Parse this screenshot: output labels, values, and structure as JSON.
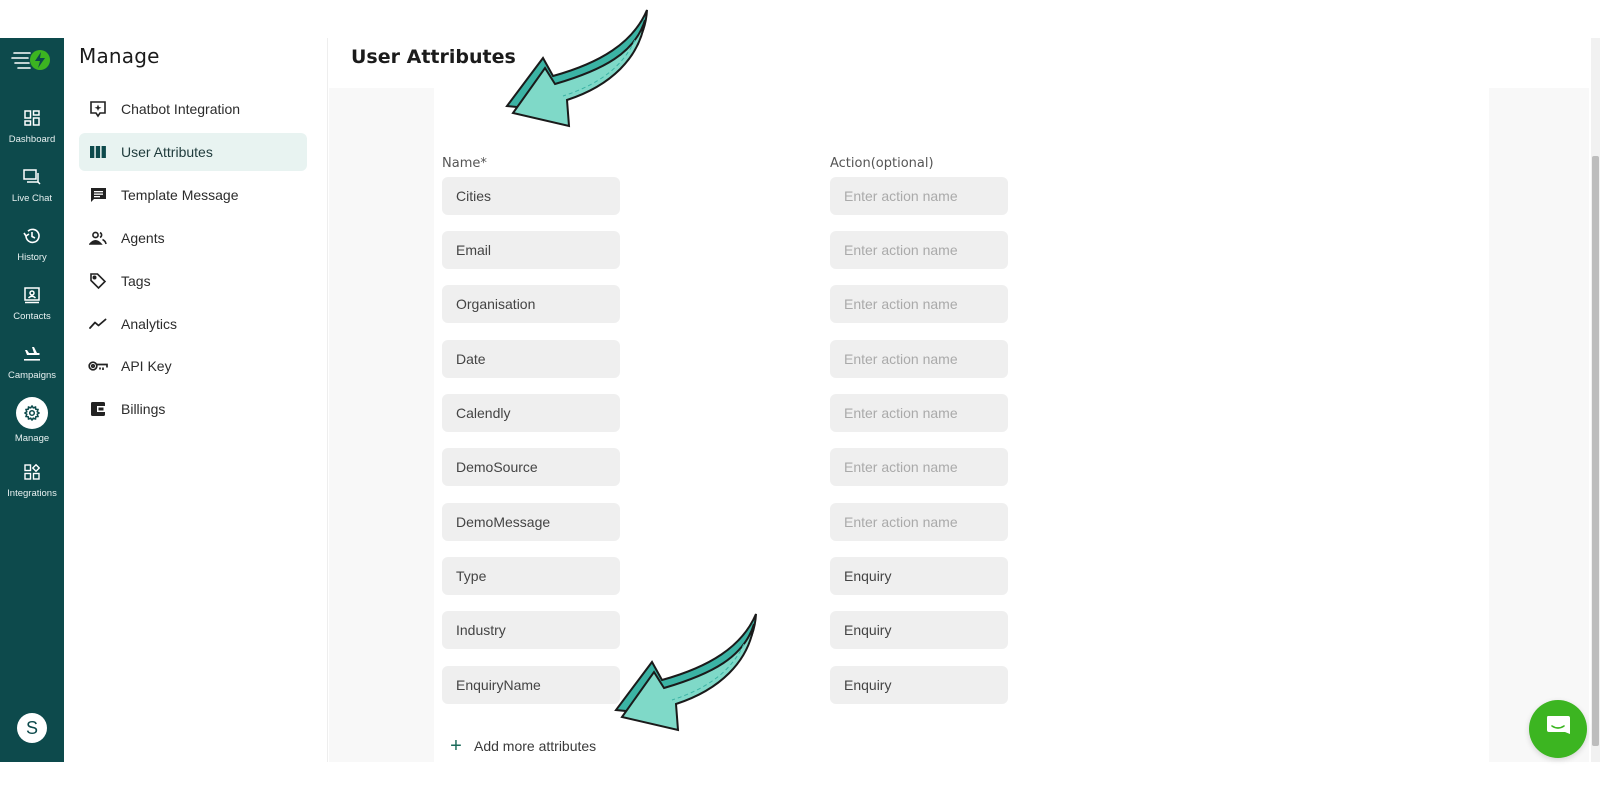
{
  "rail": {
    "items": [
      {
        "label": "Dashboard",
        "icon": "dashboard-icon"
      },
      {
        "label": "Live Chat",
        "icon": "live-chat-icon"
      },
      {
        "label": "History",
        "icon": "history-icon"
      },
      {
        "label": "Contacts",
        "icon": "contacts-icon"
      },
      {
        "label": "Campaigns",
        "icon": "campaigns-icon"
      },
      {
        "label": "Manage",
        "icon": "gear-icon",
        "active": true
      },
      {
        "label": "Integrations",
        "icon": "integrations-icon"
      }
    ],
    "avatar_initial": "S"
  },
  "sidebar": {
    "title": "Manage",
    "items": [
      {
        "label": "Chatbot Integration",
        "icon": "chatbot-icon"
      },
      {
        "label": "User Attributes",
        "icon": "columns-icon",
        "active": true
      },
      {
        "label": "Template Message",
        "icon": "message-icon"
      },
      {
        "label": "Agents",
        "icon": "agents-icon"
      },
      {
        "label": "Tags",
        "icon": "tag-icon"
      },
      {
        "label": "Analytics",
        "icon": "analytics-icon"
      },
      {
        "label": "API Key",
        "icon": "key-icon"
      },
      {
        "label": "Billings",
        "icon": "wallet-icon"
      }
    ]
  },
  "main": {
    "title": "User Attributes",
    "name_label": "Name*",
    "action_label": "Action(optional)",
    "action_placeholder": "Enter action name",
    "rows": [
      {
        "name": "Cities",
        "action": ""
      },
      {
        "name": "Email",
        "action": ""
      },
      {
        "name": "Organisation",
        "action": ""
      },
      {
        "name": "Date",
        "action": ""
      },
      {
        "name": "Calendly",
        "action": ""
      },
      {
        "name": "DemoSource",
        "action": ""
      },
      {
        "name": "DemoMessage",
        "action": ""
      },
      {
        "name": "Type",
        "action": "Enquiry"
      },
      {
        "name": "Industry",
        "action": "Enquiry"
      },
      {
        "name": "EnquiryName",
        "action": "Enquiry"
      }
    ],
    "add_label": "Add more attributes"
  },
  "colors": {
    "rail_bg": "#0d4a4c",
    "active_item_bg": "#e8f3f1",
    "field_bg": "#efefef",
    "chat_fab": "#3cb521",
    "arrow_fill": "#7fd9c8",
    "arrow_shade": "#3bb3a4"
  }
}
